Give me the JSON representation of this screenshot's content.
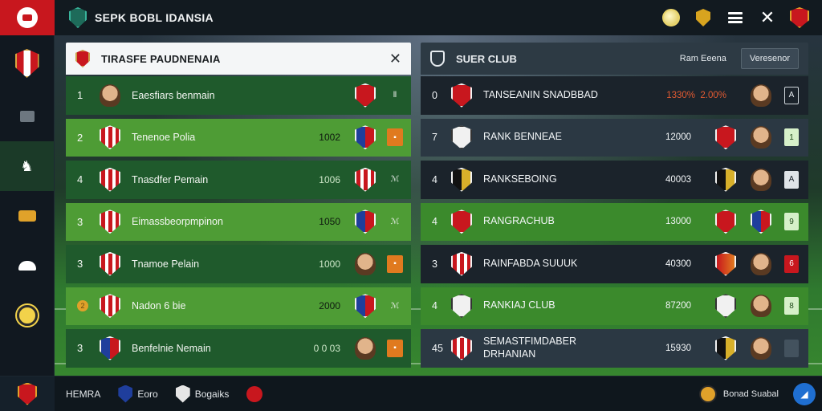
{
  "app": {
    "title": "SEPK BOBL IDANSIA"
  },
  "topbar": {
    "icons": [
      "ball-icon",
      "gold-badge-icon",
      "menu-icon",
      "close-icon",
      "club-crest-icon"
    ]
  },
  "sidebar": {
    "items": [
      {
        "icon": "club-crest-icon",
        "label": ""
      },
      {
        "icon": "square-icon",
        "label": ""
      },
      {
        "icon": "horse-icon",
        "label": ""
      },
      {
        "icon": "gold-ticket-icon",
        "label": ""
      },
      {
        "icon": "cap-icon",
        "label": ""
      },
      {
        "icon": "coin-icon",
        "label": ""
      }
    ]
  },
  "left_panel": {
    "title": "TIRASFE PAUDNENAIA",
    "rows": [
      {
        "rank": "1",
        "name": "Eaesfiars benmain",
        "value": "",
        "end_tag": ""
      },
      {
        "rank": "2",
        "name": "Tenenoe Polia",
        "value": "1002",
        "end_tag": ""
      },
      {
        "rank": "4",
        "name": "Tnasdfer Pemain",
        "value": "1006",
        "end_tag": ""
      },
      {
        "rank": "3",
        "name": "Eimassbeorpmpinon",
        "value": "1050",
        "end_tag": ""
      },
      {
        "rank": "3",
        "name": "Tnamoe Pelain",
        "value": "1000",
        "end_tag": ""
      },
      {
        "rank": "2",
        "name": "Nadon 6 bie",
        "value": "2000",
        "end_tag": ""
      },
      {
        "rank": "3",
        "name": "Benfelnie Nemain",
        "value": "0 0 03",
        "end_tag": ""
      }
    ]
  },
  "right_panel": {
    "title": "SUER CLUB",
    "col1": "Ram Eeena",
    "col2": "Veresenor",
    "rows": [
      {
        "rank": "0",
        "name": "TANSEANIN SNADBBAD",
        "score": "1330%",
        "score2": "2.00%",
        "tag": "A"
      },
      {
        "rank": "7",
        "name": "RANK BENNEAE",
        "score": "12000",
        "score2": "",
        "tag": "1"
      },
      {
        "rank": "4",
        "name": "RANKSEBOING",
        "score": "40003",
        "score2": "",
        "tag": "A"
      },
      {
        "rank": "4",
        "name": "RANGRACHUB",
        "score": "13000",
        "score2": "",
        "tag": "9"
      },
      {
        "rank": "3",
        "name": "RAINFABDA SUUUK",
        "score": "40300",
        "score2": "",
        "tag": "6"
      },
      {
        "rank": "4",
        "name": "RANKIAJ CLUB",
        "score": "87200",
        "score2": "",
        "tag": "8"
      },
      {
        "rank": "45",
        "name": "SEMASTFIMDABER DRHANIAN",
        "score": "15930",
        "score2": "",
        "tag": ""
      }
    ]
  },
  "bottombar": {
    "tabs": [
      "HEMRA",
      "Eoro",
      "Bogaiks",
      ""
    ],
    "status_label": "Bonad Suabal"
  }
}
